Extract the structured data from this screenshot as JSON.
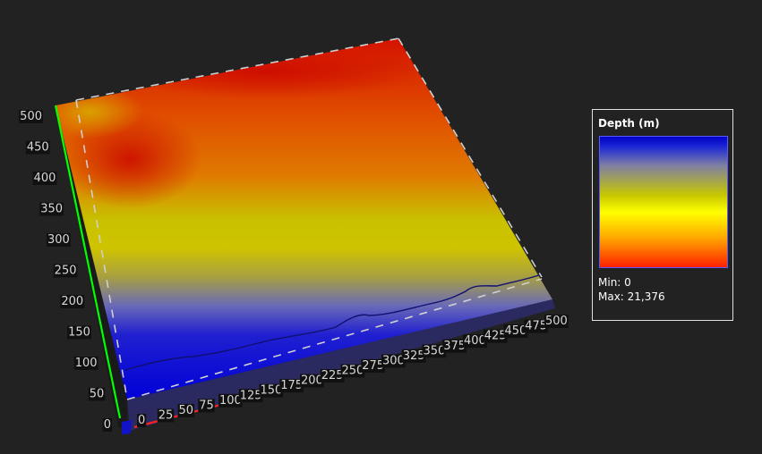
{
  "chart_data": {
    "type": "heatmap",
    "variable": "Depth (m)",
    "x_ticks": [
      "0",
      "25",
      "50",
      "75",
      "100",
      "125",
      "150",
      "175",
      "200",
      "225",
      "250",
      "275",
      "300",
      "325",
      "350",
      "375",
      "400",
      "425",
      "450",
      "475",
      "500"
    ],
    "y_ticks": [
      "0",
      "50",
      "100",
      "150",
      "200",
      "250",
      "300",
      "350",
      "400",
      "450",
      "500"
    ],
    "xlim": [
      0,
      500
    ],
    "ylim": [
      0,
      500
    ],
    "value_range": [
      0,
      21376
    ],
    "colormap": [
      "#0000c8",
      "#7f7fa4",
      "#ffff00",
      "#ffa500",
      "#ff2000"
    ],
    "axis_colors": {
      "x": "#ff2020",
      "y": "#00ff00"
    },
    "contour_level_fraction": 0.08,
    "legend": {
      "title": "Depth (m)",
      "min_text": "Min: 0",
      "max_text": "Max: 21,376",
      "placement": "right"
    }
  }
}
